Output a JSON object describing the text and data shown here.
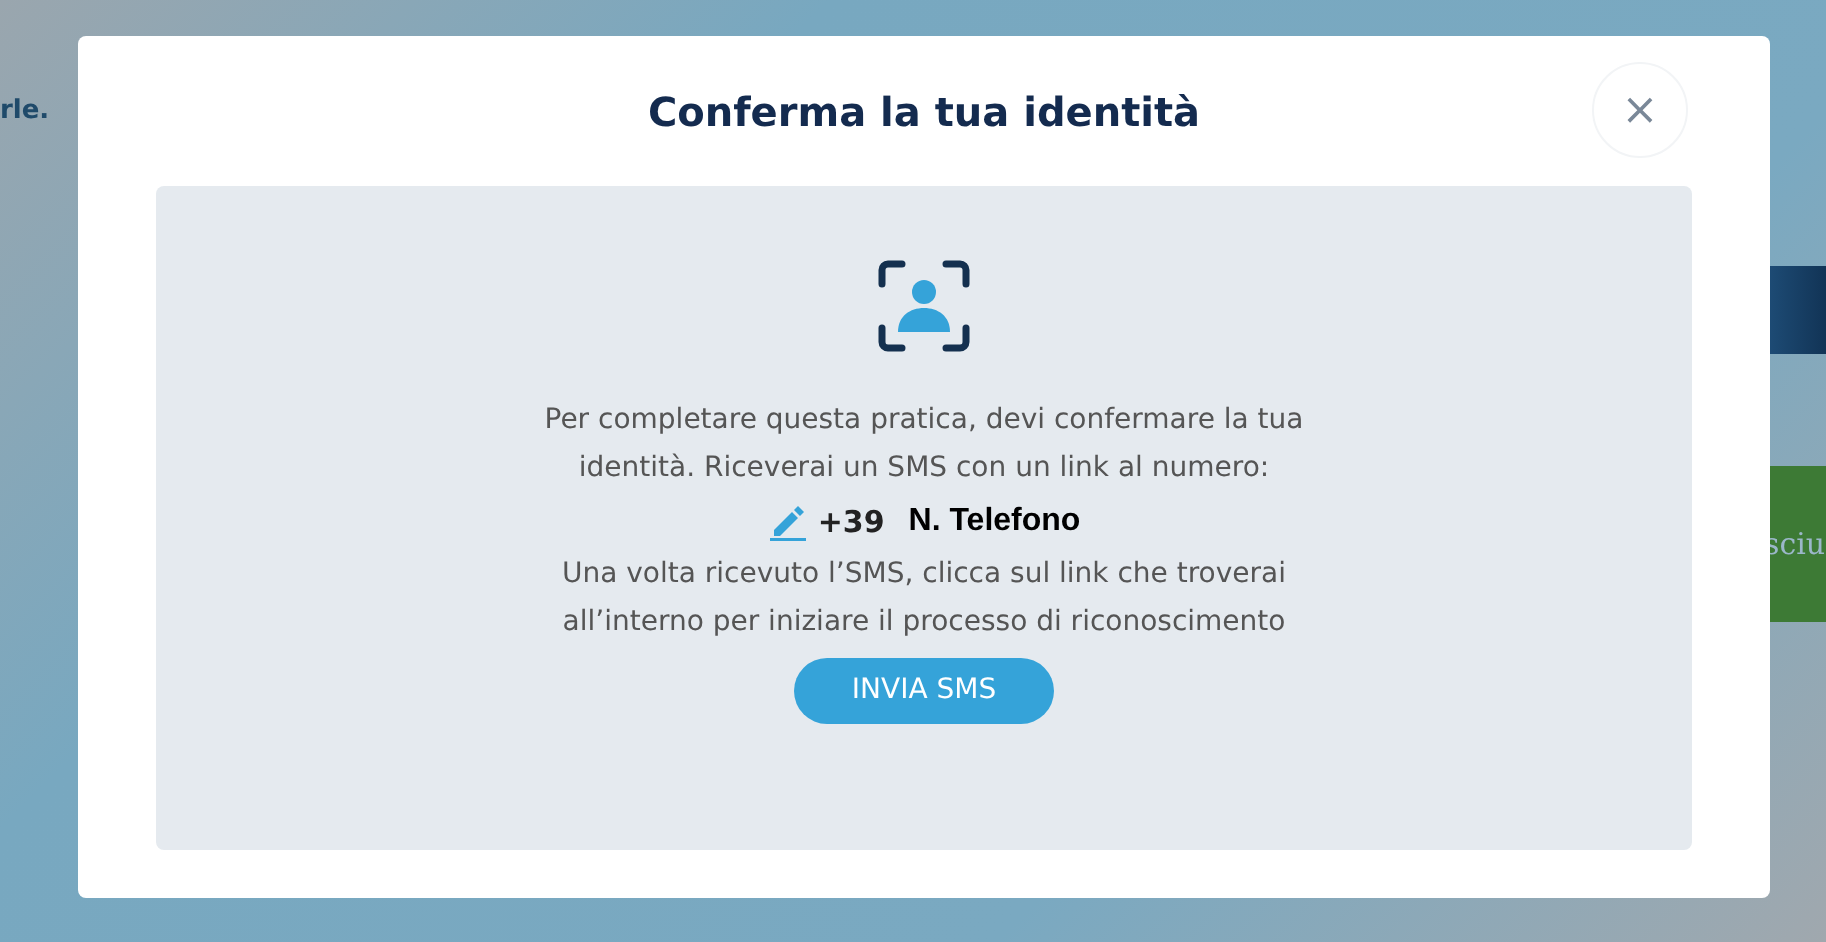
{
  "background": {
    "left_text": "rle.",
    "right_button": "sciu"
  },
  "dialog": {
    "title": "Conferma la tua identità",
    "close": "×",
    "intro": "Per completare questa pratica, devi confermare la tua identità. Riceverai un SMS con un link al numero:",
    "prefix": "+39",
    "phone": "N. Telefono",
    "instructions": "Una volta ricevuto l’SMS, clicca sul link che troverai all’interno per iniziare il processo di riconoscimento",
    "button": "INVIA SMS"
  }
}
